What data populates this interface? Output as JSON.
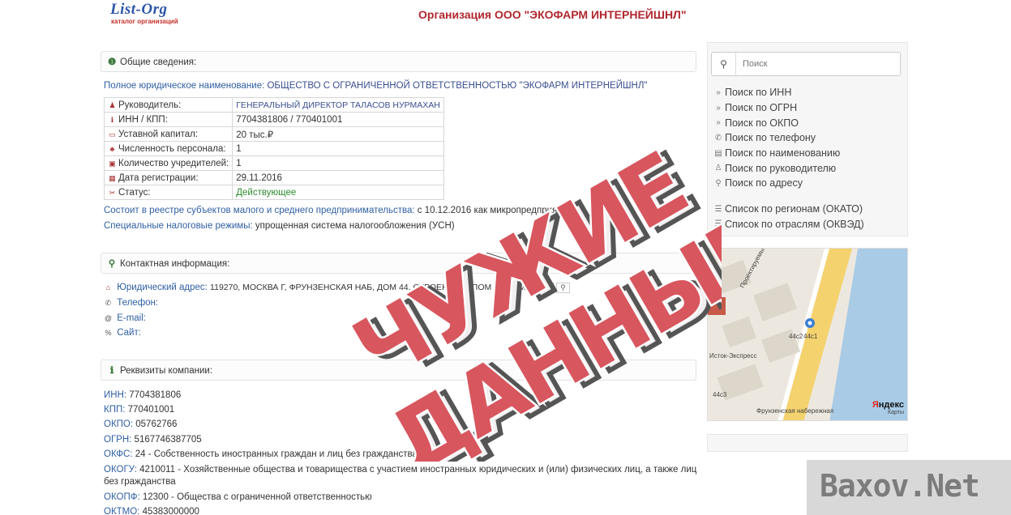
{
  "logo": {
    "main": "List-Org",
    "sub": "каталог организаций"
  },
  "page_title": "Организация ООО \"ЭКОФАРМ ИНТЕРНЕЙШНЛ\"",
  "general": {
    "heading": "Общие сведения:",
    "full_name_label": "Полное юридическое наименование:",
    "full_name_value": "ОБЩЕСТВО С ОГРАНИЧЕННОЙ ОТВЕТСТВЕННОСТЬЮ \"ЭКОФАРМ ИНТЕРНЕЙШНЛ\"",
    "rows": [
      {
        "label": "Руководитель:",
        "value": "ГЕНЕРАЛЬНЫЙ ДИРЕКТОР ТАЛАСОВ НУРМАХАН",
        "icon": "user-icon"
      },
      {
        "label": "ИНН / КПП:",
        "value": "7704381806 / 770401001",
        "icon": "info-icon"
      },
      {
        "label": "Уставной капитал:",
        "value": "20 тыс.₽",
        "icon": "money-icon"
      },
      {
        "label": "Численность персонала:",
        "value": "1",
        "icon": "people-icon"
      },
      {
        "label": "Количество учредителей:",
        "value": "1",
        "icon": "founder-icon"
      },
      {
        "label": "Дата регистрации:",
        "value": "29.11.2016",
        "icon": "calendar-icon"
      },
      {
        "label": "Статус:",
        "value": "Действующее",
        "icon": "status-icon"
      }
    ],
    "sme_label": "Состоит в реестре субъектов малого и среднего предпринимательства:",
    "sme_value": "с 10.12.2016 как микропредприятие",
    "tax_label": "Специальные налоговые режимы:",
    "tax_value": "упрощенная система налогообложения (УСН)"
  },
  "contact": {
    "heading": "Контактная информация:",
    "address_label": "Юридический адрес:",
    "address_value": "119270, МОСКВА Г, ФРУНЗЕНСКАЯ НАБ, ДОМ 44, СТРОЕНИЕ 1, ПОМ 4Н КОМ 6",
    "phone_label": "Телефон:",
    "email_label": "E-mail:",
    "site_label": "Сайт:"
  },
  "requisites": {
    "heading": "Реквизиты компании:",
    "rows": [
      {
        "label": "ИНН:",
        "value": "7704381806"
      },
      {
        "label": "КПП:",
        "value": "770401001"
      },
      {
        "label": "ОКПО:",
        "value": "05762766"
      },
      {
        "label": "ОГРН:",
        "value": "5167746387705"
      },
      {
        "label": "ОКФС:",
        "value": "24 - Собственность иностранных граждан и лиц без гражданства"
      },
      {
        "label": "ОКОГУ:",
        "value": "4210011 - Хозяйственные общества и товарищества с участием иностранных юридических и (или) физических лиц, а также лиц"
      },
      {
        "label": "",
        "value": "без гражданства"
      },
      {
        "label": "ОКОПФ:",
        "value": "12300 - Общества с ограниченной ответственностью"
      },
      {
        "label": "ОКТМО:",
        "value": "45383000000"
      }
    ]
  },
  "sidebar": {
    "search_placeholder": "Поиск",
    "links": [
      {
        "label": "Поиск по ИНН",
        "icon": "chevron-right-icon",
        "glyph": "»"
      },
      {
        "label": "Поиск по ОГРН",
        "icon": "chevron-right-icon",
        "glyph": "»"
      },
      {
        "label": "Поиск по ОКПО",
        "icon": "chevron-right-icon",
        "glyph": "»"
      },
      {
        "label": "Поиск по телефону",
        "icon": "phone-icon",
        "glyph": "✆"
      },
      {
        "label": "Поиск по наименованию",
        "icon": "document-icon",
        "glyph": "▤"
      },
      {
        "label": "Поиск по руководителю",
        "icon": "user-icon",
        "glyph": "♙"
      },
      {
        "label": "Поиск по адресу",
        "icon": "map-marker-icon",
        "glyph": "⚲"
      }
    ],
    "links2": [
      {
        "label": "Список по регионам (ОКАТО)",
        "icon": "list-icon",
        "glyph": "☰"
      },
      {
        "label": "Список по отраслям (ОКВЭД)",
        "icon": "list-icon",
        "glyph": "☰"
      }
    ]
  },
  "map": {
    "labels": [
      "Проектируемый пр.",
      "44с2",
      "44с1",
      "Исток-Экспресс",
      "Фрунзенская набережная",
      "44с3"
    ],
    "logo_prefix": "Я",
    "logo_rest": "ндекс",
    "logo_sub": "Карты"
  },
  "stamp": {
    "line1": "ЧУЖИЕ",
    "line2": "ДАННЫЕ"
  },
  "watermark": "Baxov.Net"
}
